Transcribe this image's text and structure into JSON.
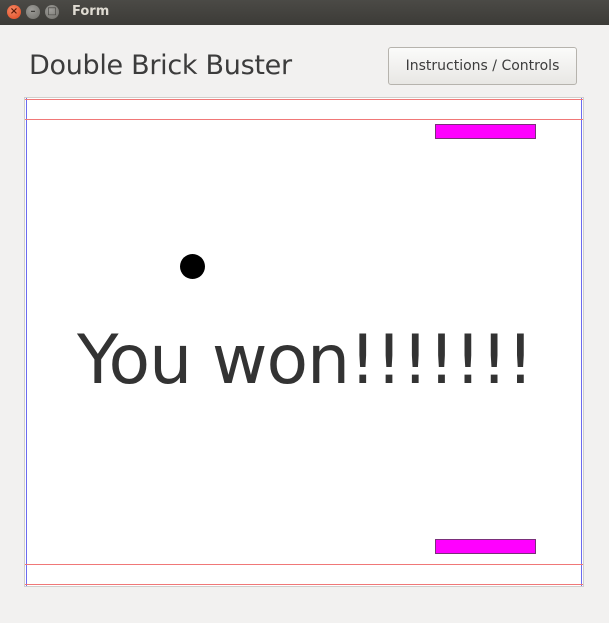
{
  "window": {
    "title": "Form",
    "close_glyph": "×",
    "minimize_glyph": "–",
    "maximize_glyph": "□"
  },
  "header": {
    "title": "Double Brick Buster",
    "instructions_label": "Instructions / Controls"
  },
  "game": {
    "message": "You won!!!!!!!",
    "paddle_color": "#ff00ff",
    "ball_color": "#000000",
    "wall_color": "#6b6bf0",
    "boundary_color": "#f07878"
  }
}
